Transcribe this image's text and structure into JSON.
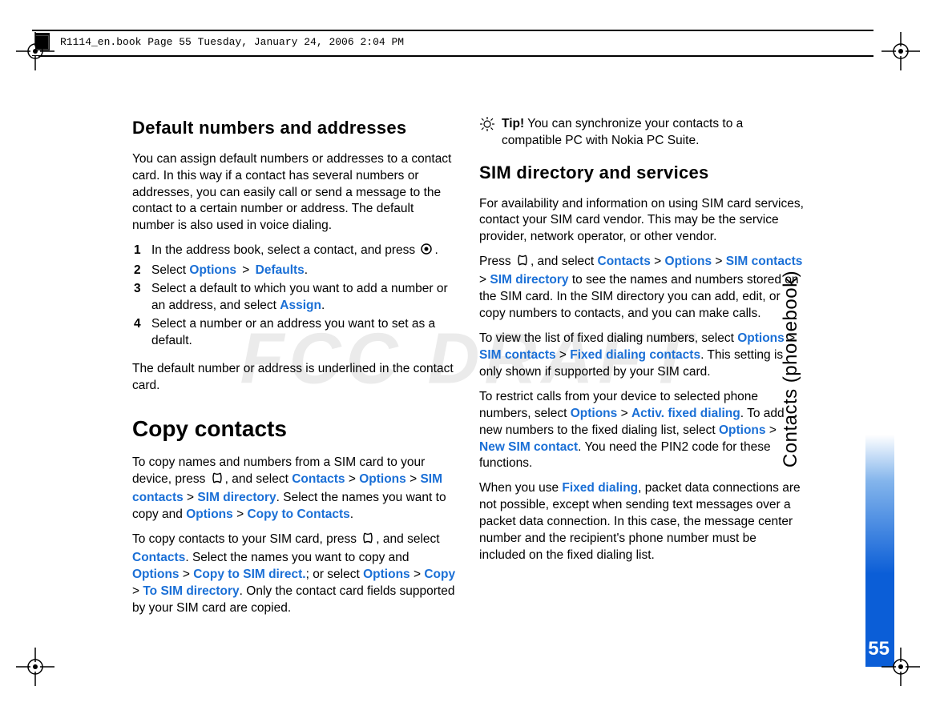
{
  "header": {
    "running_head": "R1114_en.book  Page 55  Tuesday, January 24, 2006  2:04 PM"
  },
  "watermark": "FCC DRAFT",
  "side": {
    "label": "Contacts (phonebook)",
    "page_number": "55"
  },
  "left": {
    "h1": "Default numbers and addresses",
    "p1": "You can assign default numbers or addresses to a contact card. In this way if a contact has several numbers or addresses, you can easily call or send a message to the contact to a certain number or address. The default number is also used in voice dialing.",
    "steps": [
      {
        "n": "1",
        "pre": "In the address book, select a contact, and press ",
        "post": "."
      },
      {
        "n": "2",
        "pre": "Select ",
        "a": "Options",
        "gt1": " > ",
        "b": "Defaults",
        "post": "."
      },
      {
        "n": "3",
        "pre": "Select a default to which you want to add a number or an address, and select ",
        "a": "Assign",
        "post": "."
      },
      {
        "n": "4",
        "pre": "Select a number or an address you want to set as a default."
      }
    ],
    "p2": "The default number or address is underlined in the contact card.",
    "h2": "Copy contacts",
    "p3a": "To copy names and numbers from a SIM card to your device, press ",
    "p3b": ", and select ",
    "seq3": [
      "Contacts",
      "Options",
      "SIM contacts",
      "SIM directory"
    ],
    "p3c": ". Select the names you want to copy and ",
    "seq3b": [
      "Options",
      "Copy to Contacts"
    ],
    "p3d": ".",
    "p4a": "To copy contacts to your SIM card, press ",
    "p4b": ", and select ",
    "seq4a": [
      "Contacts"
    ],
    "p4c": ". Select the names you want to copy and ",
    "seq4b": [
      "Options",
      "Copy to SIM direct."
    ],
    "p4d": "; or select ",
    "seq4c": [
      "Options",
      "Copy",
      "To SIM directory"
    ],
    "p4e": ". Only the contact card fields supported by your SIM card are copied."
  },
  "right": {
    "tip_label": "Tip!",
    "tip_text": " You can synchronize your contacts to a compatible PC with Nokia PC Suite.",
    "h1": "SIM directory and services",
    "p1": "For availability and information on using SIM card services, contact your SIM card vendor. This may be the service provider, network operator, or other vendor.",
    "p2a": "Press ",
    "p2b": ", and select ",
    "seq2": [
      "Contacts",
      "Options",
      "SIM contacts",
      "SIM directory"
    ],
    "p2c": " to see the names and numbers stored on the SIM card. In the SIM directory you can add, edit, or copy numbers to contacts, and you can make calls.",
    "p3a": "To view the list of fixed dialing numbers, select ",
    "seq3": [
      "Options",
      "SIM contacts",
      "Fixed dialing contacts"
    ],
    "p3b": ". This setting is only shown if supported by your SIM card.",
    "p4a": "To restrict calls from your device to selected phone numbers, select ",
    "seq4a": [
      "Options",
      "Activ. fixed dialing"
    ],
    "p4b": ". To add new numbers to the fixed dialing list, select ",
    "seq4b": [
      "Options",
      "New SIM contact"
    ],
    "p4c": ". You need the PIN2 code for these functions.",
    "p5a": "When you use ",
    "hl5": "Fixed dialing",
    "p5b": ", packet data connections are not possible, except when sending text messages over a packet data connection. In this case, the message center number and the recipient's phone number must be included on the fixed dialing list."
  }
}
